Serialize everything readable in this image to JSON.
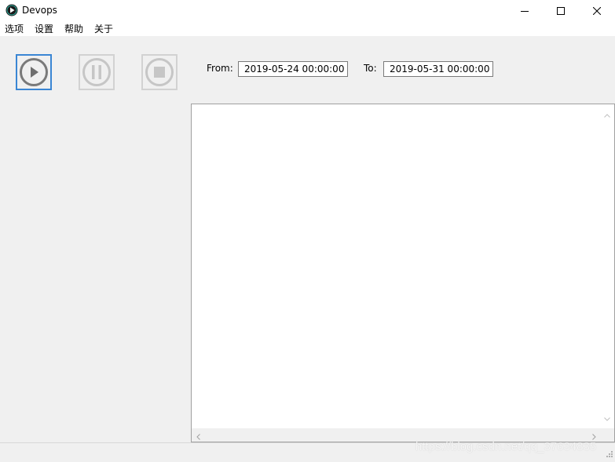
{
  "window": {
    "title": "Devops",
    "icon": "play-circle-icon"
  },
  "menu": {
    "items": [
      {
        "label": "选项"
      },
      {
        "label": "设置"
      },
      {
        "label": "帮助"
      },
      {
        "label": "关于"
      }
    ]
  },
  "toolbar": {
    "play_icon": "play-icon",
    "pause_icon": "pause-icon",
    "stop_icon": "stop-icon",
    "from_label": "From:",
    "from_value": "2019-05-24 00:00:00",
    "to_label": "To:",
    "to_value": "2019-05-31 00:00:00"
  },
  "output": {
    "text": ""
  },
  "watermark": "https://blog.csdn.net/qq_37634835",
  "colors": {
    "accent": "#3a86d4",
    "disabled": "#d2d2d2"
  }
}
